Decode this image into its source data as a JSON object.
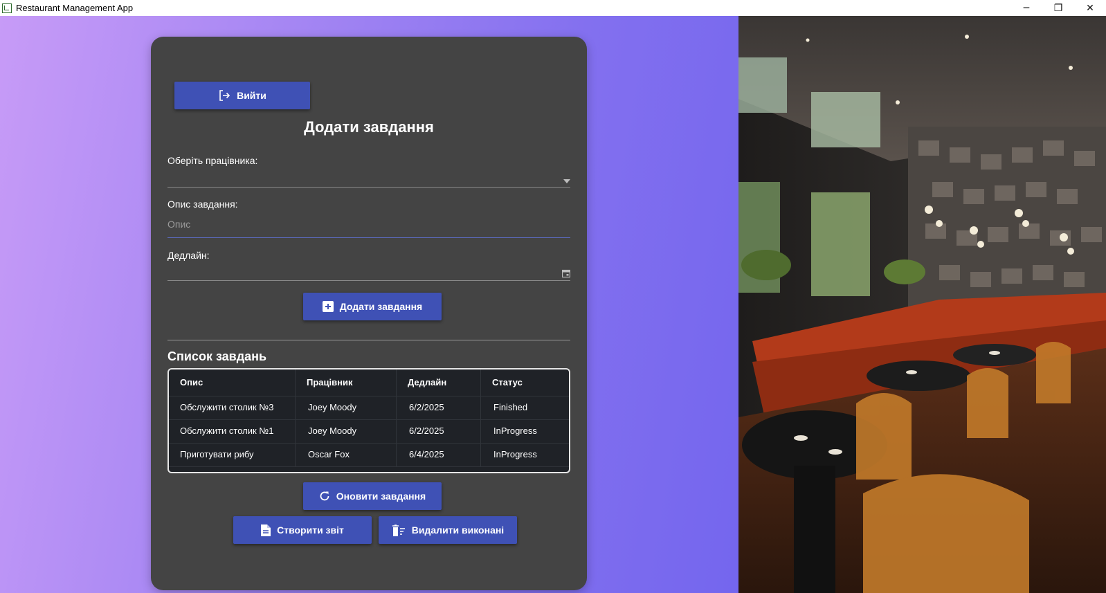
{
  "window": {
    "title": "Restaurant Management App",
    "minimize": "─",
    "maximize": "❐",
    "close": "✕"
  },
  "card": {
    "logout_label": "Вийти",
    "title": "Додати завдання",
    "employee_label": "Оберіть працівника:",
    "description_label": "Опис завдання:",
    "description_placeholder": "Опис",
    "deadline_label": "Дедлайн:",
    "add_label": "Додати завдання",
    "list_title": "Список завдань",
    "refresh_label": "Оновити завдання",
    "report_label": "Створити звіт",
    "delete_done_label": "Видалити виконані"
  },
  "table": {
    "columns": [
      "Опис",
      "Працівник",
      "Дедлайн",
      "Статус"
    ],
    "rows": [
      [
        "Обслужити столик №3",
        "Joey Moody",
        "6/2/2025",
        "Finished"
      ],
      [
        "Обслужити столик №1",
        "Joey Moody",
        "6/2/2025",
        "InProgress"
      ],
      [
        "Приготувати рибу",
        "Oscar Fox",
        "6/4/2025",
        "InProgress"
      ]
    ]
  },
  "colors": {
    "accent": "#3f51b5",
    "card": "#444444",
    "table_bg": "#1f2227",
    "gradient_start": "#c79bf7",
    "gradient_end": "#7466ee"
  },
  "icons": {
    "logout": "logout-icon",
    "add": "plus-square-icon",
    "refresh": "refresh-icon",
    "report": "document-icon",
    "delete": "trash-icon",
    "calendar": "calendar-icon",
    "dropdown": "dropdown-arrow-icon"
  }
}
